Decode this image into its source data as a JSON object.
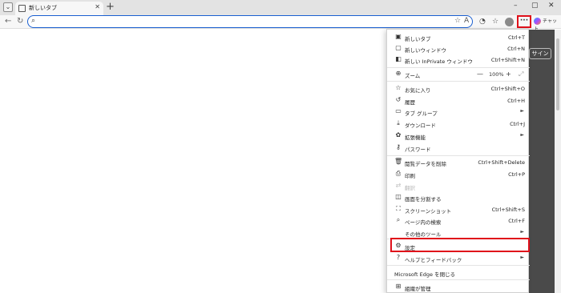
{
  "tab": {
    "title": "新しいタブ",
    "close": "✕",
    "new_tab": "+"
  },
  "window": {
    "minimize": "–",
    "maximize": "▢",
    "close": "✕"
  },
  "toolbar": {
    "back": "←",
    "reload": "↻",
    "more": "···",
    "chat_label": "チャット"
  },
  "address": {
    "value": "",
    "placeholder": ""
  },
  "page": {
    "signin": "サインイン"
  },
  "menu": {
    "items": [
      {
        "icon": "▣",
        "label": "新しいタブ",
        "shortcut": "Ctrl+T"
      },
      {
        "icon": "▢",
        "label": "新しいウィンドウ",
        "shortcut": "Ctrl+N"
      },
      {
        "icon": "◧",
        "label": "新しい InPrivate ウィンドウ",
        "shortcut": "Ctrl+Shift+N"
      },
      {
        "icon": "⊕",
        "label": "ズーム",
        "zoom_value": "100%",
        "zoom_minus": "—",
        "zoom_plus": "+",
        "zoom_full": "⤢"
      },
      {
        "icon": "☆",
        "label": "お気に入り",
        "shortcut": "Ctrl+Shift+O"
      },
      {
        "icon": "↺",
        "label": "履歴",
        "shortcut": "Ctrl+H"
      },
      {
        "icon": "▭",
        "label": "タブ グループ",
        "arrow": "►"
      },
      {
        "icon": "⤓",
        "label": "ダウンロード",
        "shortcut": "Ctrl+J"
      },
      {
        "icon": "✿",
        "label": "拡張機能",
        "arrow": "►"
      },
      {
        "icon": "⚷",
        "label": "パスワード"
      },
      {
        "icon": "🗑",
        "label": "閲覧データを削除",
        "shortcut": "Ctrl+Shift+Delete"
      },
      {
        "icon": "⎙",
        "label": "印刷",
        "shortcut": "Ctrl+P"
      },
      {
        "icon": "⇄",
        "label": "翻訳"
      },
      {
        "icon": "◫",
        "label": "画面を分割する"
      },
      {
        "icon": "⛶",
        "label": "スクリーンショット",
        "shortcut": "Ctrl+Shift+S"
      },
      {
        "icon": "⌕",
        "label": "ページ内の検索",
        "shortcut": "Ctrl+F"
      },
      {
        "label": "その他のツール",
        "arrow": "►"
      },
      {
        "icon": "⚙",
        "label": "設定"
      },
      {
        "icon": "?",
        "label": "ヘルプとフィードバック",
        "arrow": "►"
      },
      {
        "label": "Microsoft Edge を閉じる"
      },
      {
        "icon": "⊞",
        "label": "組織が管理"
      }
    ]
  },
  "colors": {
    "accent": "#1a5fd0",
    "highlight": "#e0101a"
  }
}
